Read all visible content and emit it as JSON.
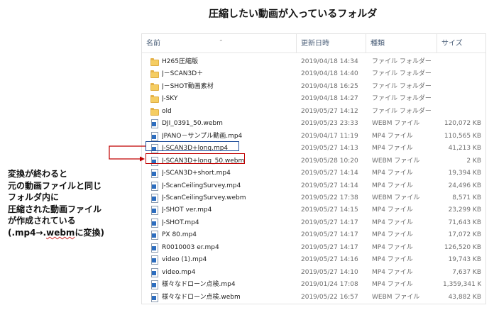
{
  "caption": "圧縮したい動画が入っているフォルダ",
  "explorer": {
    "columns": {
      "name": "名前",
      "date": "更新日時",
      "type": "種類",
      "size": "サイズ"
    },
    "rows": [
      {
        "name": "H265圧縮版",
        "date": "2019/04/18 14:34",
        "type": "ファイル フォルダー",
        "size": "",
        "icon": "folder-icon"
      },
      {
        "name": "J－SCAN3D＋",
        "date": "2019/04/18 14:40",
        "type": "ファイル フォルダー",
        "size": "",
        "icon": "folder-icon"
      },
      {
        "name": "J－SHOT動画素材",
        "date": "2019/04/18 16:25",
        "type": "ファイル フォルダー",
        "size": "",
        "icon": "folder-icon"
      },
      {
        "name": "J-SKY",
        "date": "2019/04/18 14:27",
        "type": "ファイル フォルダー",
        "size": "",
        "icon": "folder-icon"
      },
      {
        "name": "old",
        "date": "2019/05/27 14:12",
        "type": "ファイル フォルダー",
        "size": "",
        "icon": "folder-icon"
      },
      {
        "name": "DJI_0391_50.webm",
        "date": "2019/05/23 23:33",
        "type": "WEBM ファイル",
        "size": "120,072 KB",
        "icon": "video-file-icon"
      },
      {
        "name": "JPANO－サンプル動画.mp4",
        "date": "2019/04/17 11:19",
        "type": "MP4 ファイル",
        "size": "110,565 KB",
        "icon": "video-file-icon"
      },
      {
        "name": "J-SCAN3D+long.mp4",
        "date": "2019/05/27 14:13",
        "type": "MP4 ファイル",
        "size": "41,213 KB",
        "icon": "video-file-icon"
      },
      {
        "name": "J-SCAN3D+long_50.webm",
        "date": "2019/05/28 10:20",
        "type": "WEBM ファイル",
        "size": "2 KB",
        "icon": "video-file-icon"
      },
      {
        "name": "J-SCAN3D+short.mp4",
        "date": "2019/05/27 14:14",
        "type": "MP4 ファイル",
        "size": "19,394 KB",
        "icon": "video-file-icon"
      },
      {
        "name": "J-ScanCeilingSurvey.mp4",
        "date": "2019/05/27 14:14",
        "type": "MP4 ファイル",
        "size": "24,496 KB",
        "icon": "video-file-icon"
      },
      {
        "name": "J-ScanCeilingSurvey.webm",
        "date": "2019/05/22 17:38",
        "type": "WEBM ファイル",
        "size": "8,571 KB",
        "icon": "video-file-icon"
      },
      {
        "name": "J-SHOT ver.mp4",
        "date": "2019/05/27 14:15",
        "type": "MP4 ファイル",
        "size": "23,299 KB",
        "icon": "video-file-icon"
      },
      {
        "name": "J-SHOT.mp4",
        "date": "2019/05/27 14:17",
        "type": "MP4 ファイル",
        "size": "71,643 KB",
        "icon": "video-file-icon"
      },
      {
        "name": "PX 80.mp4",
        "date": "2019/05/27 14:17",
        "type": "MP4 ファイル",
        "size": "17,072 KB",
        "icon": "video-file-icon"
      },
      {
        "name": "R0010003 er.mp4",
        "date": "2019/05/27 14:17",
        "type": "MP4 ファイル",
        "size": "126,520 KB",
        "icon": "video-file-icon"
      },
      {
        "name": "video (1).mp4",
        "date": "2019/05/27 14:16",
        "type": "MP4 ファイル",
        "size": "19,743 KB",
        "icon": "video-file-icon"
      },
      {
        "name": "video.mp4",
        "date": "2019/05/27 14:10",
        "type": "MP4 ファイル",
        "size": "7,637 KB",
        "icon": "video-file-icon"
      },
      {
        "name": "様々なドローン点検.mp4",
        "date": "2019/01/24 17:08",
        "type": "MP4 ファイル",
        "size": "1,359,341 KB",
        "icon": "video-file-icon"
      },
      {
        "name": "様々なドローン点検.webm",
        "date": "2019/05/22 16:57",
        "type": "WEBM ファイル",
        "size": "43,882 KB",
        "icon": "video-file-icon"
      }
    ]
  },
  "callout": {
    "lines": [
      "変換が終わると",
      "元の動画ファイルと同じ",
      "フォルダ内に",
      "圧縮された動画ファイル",
      "が作成されている"
    ],
    "last_line_prefix": "(.mp4→.",
    "last_line_webm": "webm",
    "last_line_suffix": "に変換)"
  },
  "colors": {
    "highlight_original": "#1f4e9a",
    "highlight_converted": "#c00000",
    "folder": "#f5cd62",
    "header_text": "#4c607a"
  }
}
